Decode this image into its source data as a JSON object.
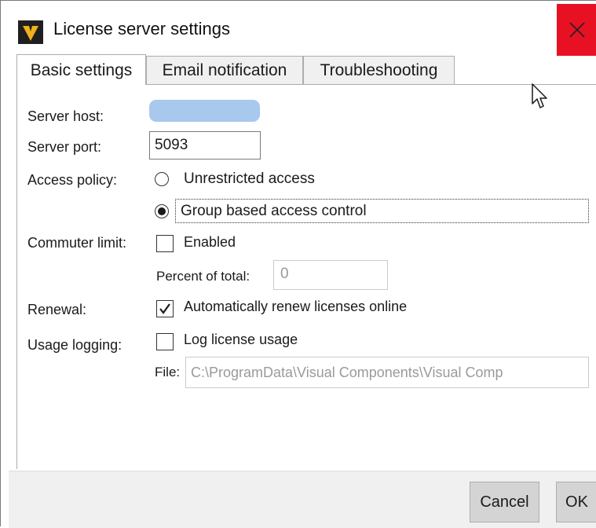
{
  "window": {
    "title": "License server settings"
  },
  "icons": {
    "app": "app-logo-icon",
    "close": "close-icon",
    "cursor": "mouse-pointer-icon"
  },
  "colors": {
    "close_bg": "#e81123",
    "host_redacted": "#a8c8ee",
    "logo_bg": "#1f1f1f",
    "logo_fg": "#f2b11b"
  },
  "tabs": [
    {
      "label": "Basic settings",
      "active": true
    },
    {
      "label": "Email notification",
      "active": false
    },
    {
      "label": "Troubleshooting",
      "active": false
    }
  ],
  "form": {
    "server_host": {
      "label": "Server host:",
      "value": ""
    },
    "server_port": {
      "label": "Server port:",
      "value": "5093"
    },
    "access_policy": {
      "label": "Access policy:",
      "options": [
        {
          "label": "Unrestricted access",
          "selected": false
        },
        {
          "label": "Group based access control",
          "selected": true
        }
      ]
    },
    "commuter_limit": {
      "label": "Commuter limit:",
      "enabled_label": "Enabled",
      "enabled": false,
      "percent_label": "Percent of total:",
      "percent_value": "0"
    },
    "renewal": {
      "label": "Renewal:",
      "option_label": "Automatically renew licenses online",
      "checked": true
    },
    "usage_logging": {
      "label": "Usage logging:",
      "option_label": "Log license usage",
      "checked": false,
      "file_label": "File:",
      "file_value": "C:\\ProgramData\\Visual Components\\Visual Comp"
    }
  },
  "footer": {
    "cancel_label": "Cancel",
    "ok_label": "OK"
  }
}
